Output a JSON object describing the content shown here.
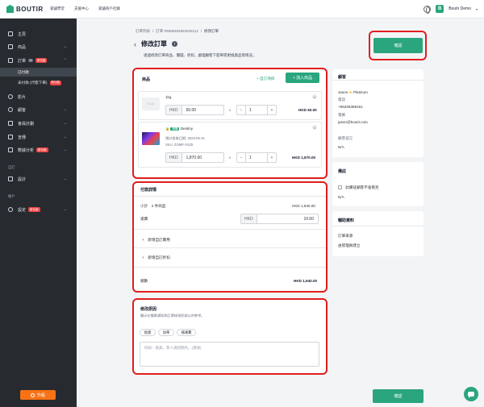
{
  "topbar": {
    "brand": "BOUTIR",
    "nav": [
      "掌舖學堂",
      "支援中心",
      "掌舖商戶社群"
    ],
    "store_name": "Boutir Demo",
    "caret": "▾"
  },
  "sidebar": {
    "items": [
      {
        "label": "主頁"
      },
      {
        "label": "商品"
      },
      {
        "label": "訂單",
        "count": "3",
        "badge": "新功能"
      },
      {
        "label": "影片"
      },
      {
        "label": "顧客"
      },
      {
        "label": "會員計劃"
      },
      {
        "label": "宣傳"
      },
      {
        "label": "數據分析",
        "badge": "新功能"
      },
      {
        "label": "設計"
      },
      {
        "label": "設定",
        "badge": "新功能"
      }
    ],
    "sub_items": [
      {
        "label": "已付款"
      },
      {
        "label": "未付款 (代客下單)",
        "badge": "新功能"
      }
    ],
    "sections": [
      "自訂",
      "帳戶"
    ],
    "upgrade_label": "升級"
  },
  "breadcrumb": [
    "訂單列表",
    "/",
    "訂單 #5808484852826112",
    "/",
    "修改訂單"
  ],
  "page": {
    "back": "‹",
    "title": "修改訂單",
    "info": "i",
    "subtitle": "透過修改訂單商品、價錢、折扣，處理顧客下錯單或更換貨品等情況。",
    "confirm_label": "確認"
  },
  "products_card": {
    "title": "商品",
    "add_custom": "+  自訂項目",
    "add_product": "+  加入商品",
    "items": [
      {
        "image_label": "Boutir",
        "name": "1kg",
        "currency": "HKD",
        "price": "60.00",
        "times": "x",
        "qty": "1",
        "total": "HKD 60.00"
      },
      {
        "lock": "🔒",
        "tag": "預購",
        "name": "Destiny",
        "meta1": "預計發貨日期: 2023-05-31",
        "meta2": "SKU: ZOMP-X425",
        "currency": "HKD",
        "price": "1,870.00",
        "times": "x",
        "qty": "1",
        "total": "HKD 1,870.00"
      }
    ]
  },
  "payment_card": {
    "title": "付款詳情",
    "subtotal_label": "小計　2 件商品",
    "subtotal_value": "HKD 1,930.00",
    "shipping_label": "運費",
    "shipping_currency": "HKD",
    "shipping_value": "10.00",
    "add_fee": "+　新增自訂費用",
    "add_discount": "+　新增自訂折扣",
    "total_label": "總數",
    "total_value": "HKD 1,940.00"
  },
  "reason_card": {
    "title": "修改原因",
    "subtitle": "顯示在電郵通知和訂單修改紀錄以供參考。",
    "chips": [
      "換貨",
      "加單",
      "補運費"
    ],
    "placeholder": "例如：換貨，客人選錯顏色。(選填)"
  },
  "customer_card": {
    "title": "顧客",
    "name": "Jason",
    "tier": "Platinum",
    "phone_label": "電話",
    "phone": "+85269388191",
    "email_label": "電郵",
    "email": "jason@boutir.com",
    "note_label": "顧客留言",
    "note": "N/A"
  },
  "remark_card": {
    "title": "備註",
    "checkbox_label": "此備註顧客不會看見",
    "value": "N/A"
  },
  "aux_card": {
    "title": "輔助資料",
    "source_label": "訂單來源",
    "source": "由管理員建立"
  },
  "icons": {
    "close": "×",
    "minus": "−",
    "plus": "+",
    "star": "★",
    "chevron": "⌄"
  },
  "colors": {
    "accent": "#2aa57d",
    "sidebar": "#272b30",
    "highlight": "#e11d1d",
    "upgrade": "#f97316"
  }
}
